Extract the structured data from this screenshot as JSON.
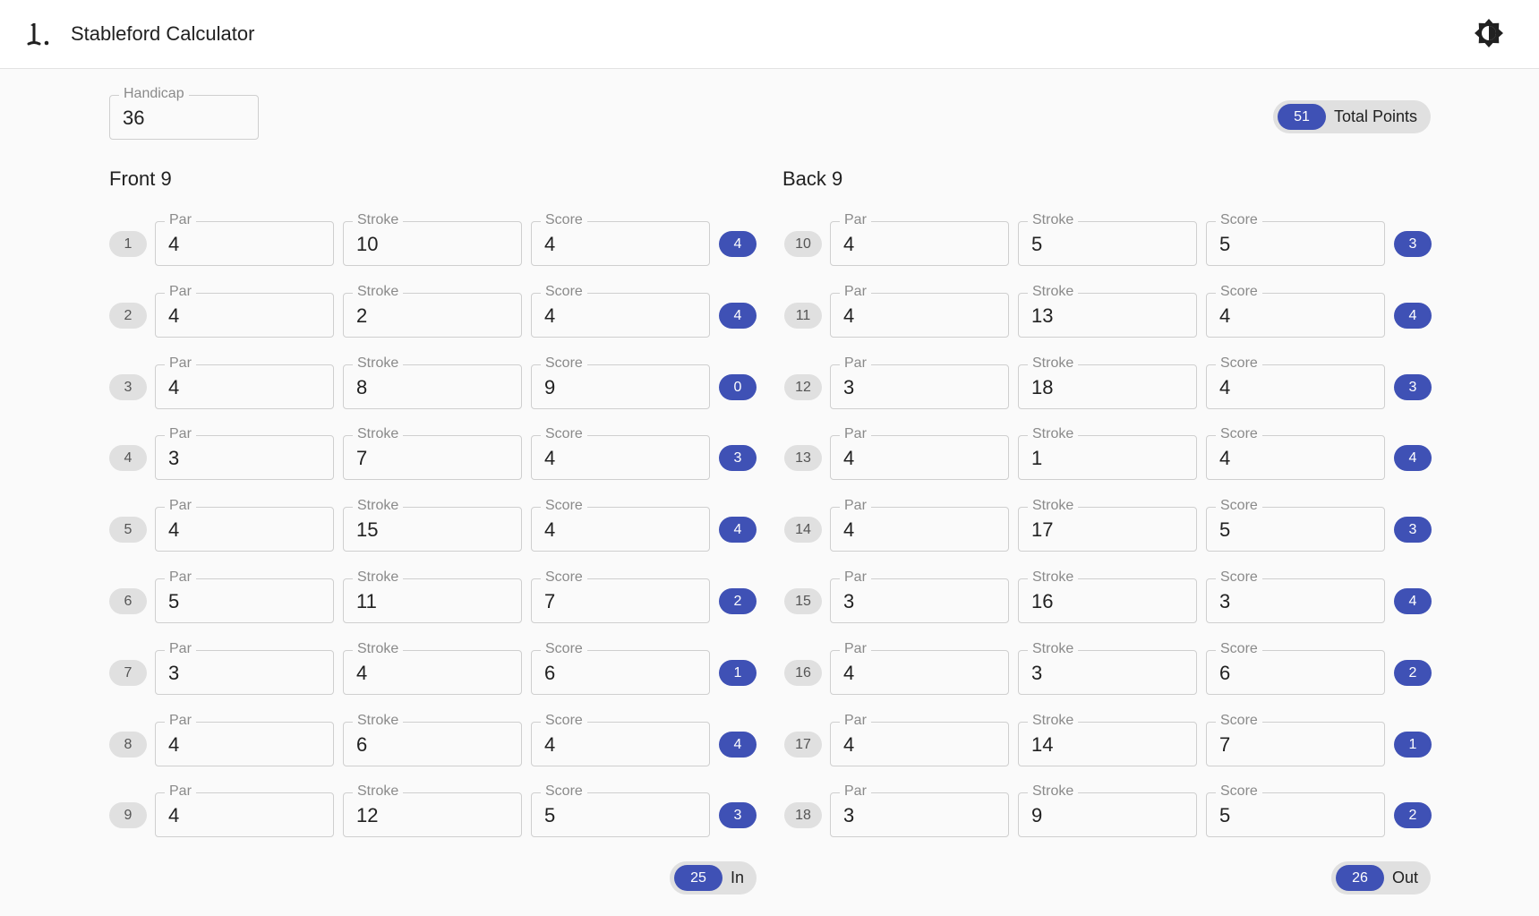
{
  "app": {
    "title": "Stableford Calculator",
    "logo_icon": "golf-flag-icon",
    "theme_icon": "brightness-toggle-icon"
  },
  "handicap": {
    "label": "Handicap",
    "value": "36"
  },
  "totals": {
    "total_points": {
      "value": "51",
      "label": "Total Points"
    },
    "front_total": {
      "value": "25",
      "label": "In"
    },
    "back_total": {
      "value": "26",
      "label": "Out"
    }
  },
  "labels": {
    "par": "Par",
    "stroke": "Stroke",
    "score": "Score"
  },
  "front": {
    "title": "Front 9",
    "holes": [
      {
        "hole": "1",
        "par": "4",
        "stroke": "10",
        "score": "4",
        "points": "4"
      },
      {
        "hole": "2",
        "par": "4",
        "stroke": "2",
        "score": "4",
        "points": "4"
      },
      {
        "hole": "3",
        "par": "4",
        "stroke": "8",
        "score": "9",
        "points": "0"
      },
      {
        "hole": "4",
        "par": "3",
        "stroke": "7",
        "score": "4",
        "points": "3"
      },
      {
        "hole": "5",
        "par": "4",
        "stroke": "15",
        "score": "4",
        "points": "4"
      },
      {
        "hole": "6",
        "par": "5",
        "stroke": "11",
        "score": "7",
        "points": "2"
      },
      {
        "hole": "7",
        "par": "3",
        "stroke": "4",
        "score": "6",
        "points": "1"
      },
      {
        "hole": "8",
        "par": "4",
        "stroke": "6",
        "score": "4",
        "points": "4"
      },
      {
        "hole": "9",
        "par": "4",
        "stroke": "12",
        "score": "5",
        "points": "3"
      }
    ]
  },
  "back": {
    "title": "Back 9",
    "holes": [
      {
        "hole": "10",
        "par": "4",
        "stroke": "5",
        "score": "5",
        "points": "3"
      },
      {
        "hole": "11",
        "par": "4",
        "stroke": "13",
        "score": "4",
        "points": "4"
      },
      {
        "hole": "12",
        "par": "3",
        "stroke": "18",
        "score": "4",
        "points": "3"
      },
      {
        "hole": "13",
        "par": "4",
        "stroke": "1",
        "score": "4",
        "points": "4"
      },
      {
        "hole": "14",
        "par": "4",
        "stroke": "17",
        "score": "5",
        "points": "3"
      },
      {
        "hole": "15",
        "par": "3",
        "stroke": "16",
        "score": "3",
        "points": "4"
      },
      {
        "hole": "16",
        "par": "4",
        "stroke": "3",
        "score": "6",
        "points": "2"
      },
      {
        "hole": "17",
        "par": "4",
        "stroke": "14",
        "score": "7",
        "points": "1"
      },
      {
        "hole": "18",
        "par": "3",
        "stroke": "9",
        "score": "5",
        "points": "2"
      }
    ]
  },
  "colors": {
    "accent": "#3f51b5",
    "chip_bg": "#e0e0e0",
    "field_border": "#cfcfcf",
    "page_bg": "#fafafa"
  }
}
